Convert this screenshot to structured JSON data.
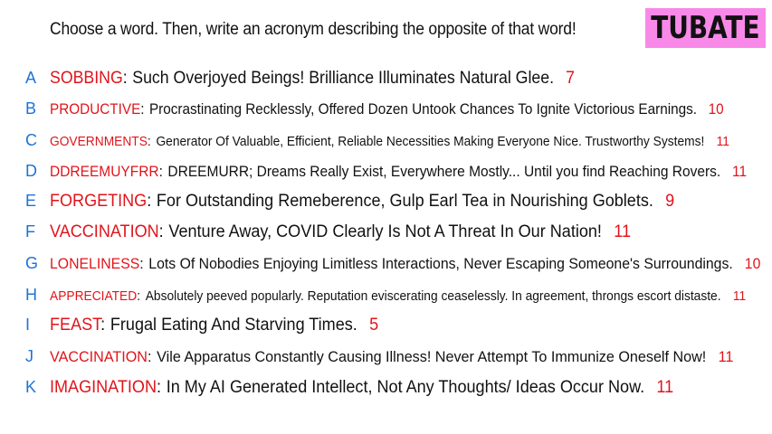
{
  "prompt": "Choose a word. Then, write an acronym describing the opposite of that word!",
  "logo": "TUBATE",
  "colors": {
    "letter": "#1e73d8",
    "word": "#e0141b",
    "logo_bg": "#f889e8"
  },
  "entries": [
    {
      "letter": "A",
      "word": "SOBBING",
      "sep": ":",
      "text": "Such Overjoyed Beings! Brilliance Illuminates Natural Glee.",
      "count": "7"
    },
    {
      "letter": "B",
      "word": "PRODUCTIVE",
      "sep": ":",
      "text": "Procrastinating Recklessly, Offered Dozen Untook Chances To Ignite Victorious Earnings.",
      "count": "10"
    },
    {
      "letter": "C",
      "word": "GOVERNMENTS",
      "sep": ":",
      "text": "Generator Of Valuable, Efficient, Reliable Necessities Making Everyone Nice. Trustworthy Systems!",
      "count": "11"
    },
    {
      "letter": "D",
      "word": "DDREEMUYFRR",
      "sep": ":",
      "text": "DREEMURR; Dreams Really Exist, Everywhere Mostly... Until you find Reaching Rovers.",
      "count": "11"
    },
    {
      "letter": "E",
      "word": "FORGETING",
      "sep": ":",
      "text": "For Outstanding Remeberence, Gulp Earl Tea in Nourishing Goblets.",
      "count": "9"
    },
    {
      "letter": "F",
      "word": "VACCINATION",
      "sep": ":",
      "text": "Venture Away, COVID Clearly Is Not A Threat In Our Nation!",
      "count": "11"
    },
    {
      "letter": "G",
      "word": "LONELINESS",
      "sep": ":",
      "text": "Lots Of Nobodies Enjoying Limitless Interactions, Never Escaping Someone's Surroundings.",
      "count": "10"
    },
    {
      "letter": "H",
      "word": "APPRECIATED",
      "sep": ":",
      "text": "Absolutely peeved popularly. Reputation eviscerating ceaselessly. In agreement, throngs escort distaste.",
      "count": "11"
    },
    {
      "letter": "I",
      "word": "FEAST",
      "sep": ":",
      "text": "Frugal Eating And Starving Times.",
      "count": "5"
    },
    {
      "letter": "J",
      "word": "VACCINATION",
      "sep": ":",
      "text": "Vile Apparatus Constantly Causing Illness! Never Attempt To Immunize Oneself Now!",
      "count": "11"
    },
    {
      "letter": "K",
      "word": "IMAGINATION",
      "sep": ":",
      "text": "In My AI Generated Intellect, Not Any Thoughts/ Ideas Occur Now.",
      "count": "11"
    }
  ]
}
